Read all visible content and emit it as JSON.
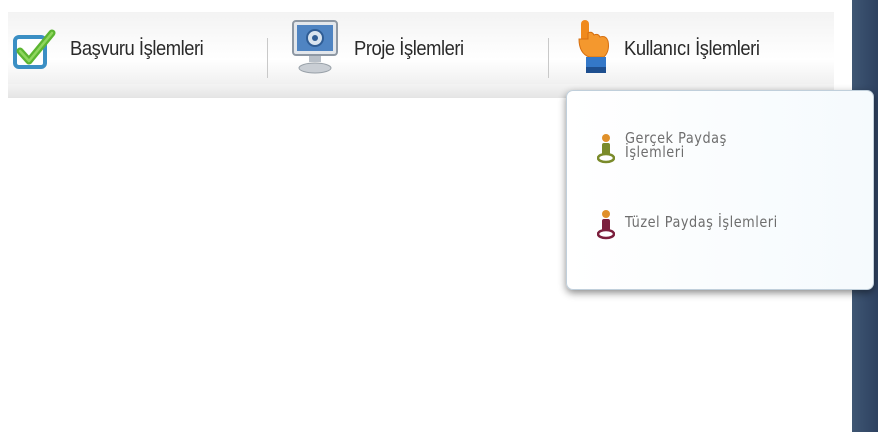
{
  "menu": {
    "items": [
      {
        "label": "Başvuru İşlemleri",
        "icon": "checkbox-check-icon"
      },
      {
        "label": "Proje İşlemleri",
        "icon": "computer-settings-icon"
      },
      {
        "label": "Kullanıcı İşlemleri",
        "icon": "pointing-hand-icon"
      }
    ]
  },
  "dropdown": {
    "items": [
      {
        "label_line1": "Gerçek Paydaş",
        "label_line2": "İşlemleri",
        "icon": "person-pin-green-icon",
        "icon_color": "#7a8a2a"
      },
      {
        "label_line1": "Tüzel Paydaş İşlemleri",
        "label_line2": "",
        "icon": "person-pin-maroon-icon",
        "icon_color": "#7b1f3d"
      }
    ]
  },
  "colors": {
    "check_green": "#5cb531",
    "checkbox_blue": "#3b8fc4",
    "hand_orange": "#f08a1c",
    "sidebar_dark": "#2d4160"
  }
}
